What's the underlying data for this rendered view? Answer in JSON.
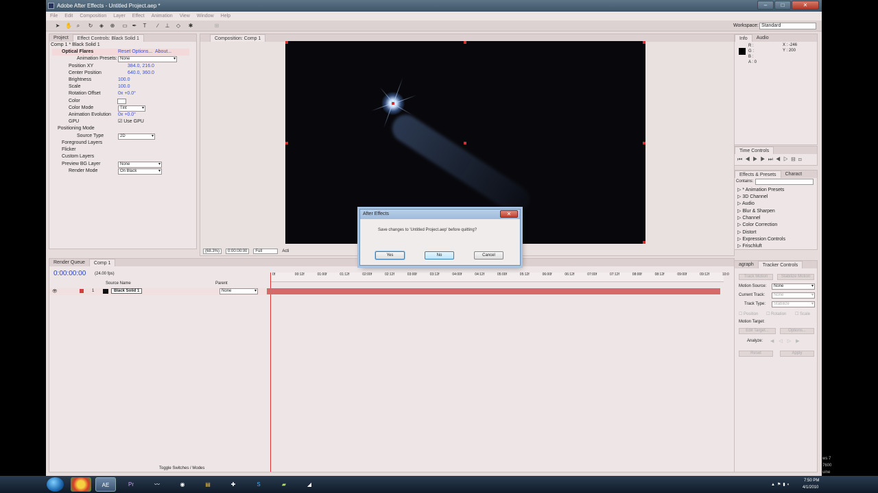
{
  "window": {
    "title": "Adobe After Effects - Untitled Project.aep *"
  },
  "menu": [
    "File",
    "Edit",
    "Composition",
    "Layer",
    "Effect",
    "Animation",
    "View",
    "Window",
    "Help"
  ],
  "toolbar": {
    "workspace_label": "Workspace:",
    "workspace_value": "Standard"
  },
  "project_panel": {
    "tabs": [
      "Project",
      "Effect Controls: Black Solid 1"
    ],
    "breadcrumb": "Comp 1 * Black Solid 1",
    "effect_name": "Optical Flares",
    "reset_options": "Reset Options...",
    "about": "About...",
    "rows": [
      {
        "label": "Animation Presets:",
        "value": "None"
      },
      {
        "label": "Position XY",
        "value": "384.0, 216.0"
      },
      {
        "label": "Center Position",
        "value": "640.0, 360.0"
      },
      {
        "label": "Brightness",
        "value": "100.0"
      },
      {
        "label": "Scale",
        "value": "100.0"
      },
      {
        "label": "Rotation Offset",
        "value": "0x +0.0°"
      },
      {
        "label": "Color",
        "value": ""
      },
      {
        "label": "Color Mode",
        "value": "Tint"
      },
      {
        "label": "Animation Evolution",
        "value": "0x +0.0°"
      },
      {
        "label": "GPU",
        "value": "Use GPU"
      },
      {
        "label": "Positioning Mode",
        "value": ""
      },
      {
        "label": "Source Type",
        "value": "2D"
      },
      {
        "label": "Foreground Layers",
        "value": ""
      },
      {
        "label": "Flicker",
        "value": ""
      },
      {
        "label": "Custom Layers",
        "value": ""
      },
      {
        "label": "Preview BG Layer",
        "value": "None"
      },
      {
        "label": "Render Mode",
        "value": "On Black"
      }
    ]
  },
  "composition": {
    "tab": "Composition: Comp 1",
    "zoom": "(68.3%)",
    "timecode": "0:00:00:00",
    "resolution": "Full",
    "active": "Acti"
  },
  "dialog": {
    "title": "After Effects",
    "message": "Save changes to 'Untitled Project.aep' before quitting?",
    "yes": "Yes",
    "no": "No",
    "cancel": "Cancel"
  },
  "info_panel": {
    "tabs": [
      "Info",
      "Audio"
    ],
    "rgba": "R :\nG :\nB :\nA : 0",
    "x": "X : -246",
    "y": "Y : 200"
  },
  "time_controls": {
    "tab": "Time Controls"
  },
  "effects_presets": {
    "tabs": [
      "Effects & Presets",
      "Charact"
    ],
    "contains_label": "Contains:",
    "items": [
      "* Animation Presets",
      "3D Channel",
      "Audio",
      "Blur & Sharpen",
      "Channel",
      "Color Correction",
      "Distort",
      "Expression Controls",
      "Frischluft"
    ]
  },
  "tracker": {
    "tabs": [
      "agraph",
      "Tracker Controls"
    ],
    "track_motion": "Track Motion",
    "stabilize_motion": "Stabilize Motion",
    "motion_source_label": "Motion Source:",
    "motion_source_value": "None",
    "current_track_label": "Current Track:",
    "current_track_value": "None",
    "track_type_label": "Track Type:",
    "track_type_value": "Stabilize",
    "position": "Position",
    "rotation": "Rotation",
    "scale": "Scale",
    "motion_target": "Motion Target:",
    "edit_target": "Edit Target...",
    "options": "Options...",
    "analyze": "Analyze:",
    "reset": "Reset",
    "apply": "Apply"
  },
  "timeline": {
    "tabs": [
      "Render Queue",
      "Comp 1"
    ],
    "timecode": "0:00:00:00",
    "fps": "(24.00 fps)",
    "col_source": "Source Name",
    "col_parent": "Parent",
    "layer_num": "1",
    "layer_name": "Black Solid 1",
    "layer_parent": "None",
    "ruler": [
      "0f",
      "00:12f",
      "01:00f",
      "01:12f",
      "02:00f",
      "02:12f",
      "03:00f",
      "03:12f",
      "04:00f",
      "04:12f",
      "05:00f",
      "05:12f",
      "06:00f",
      "06:12f",
      "07:00f",
      "07:12f",
      "08:00f",
      "08:12f",
      "09:00f",
      "09:12f",
      "10:0"
    ],
    "toggle": "Toggle Switches / Modes"
  },
  "taskbar": {
    "apps": [
      "AE",
      "Pr"
    ],
    "time": "7:50 PM",
    "date": "4/1/2010"
  },
  "side_text": [
    "ws 7",
    "7600",
    "uine"
  ]
}
